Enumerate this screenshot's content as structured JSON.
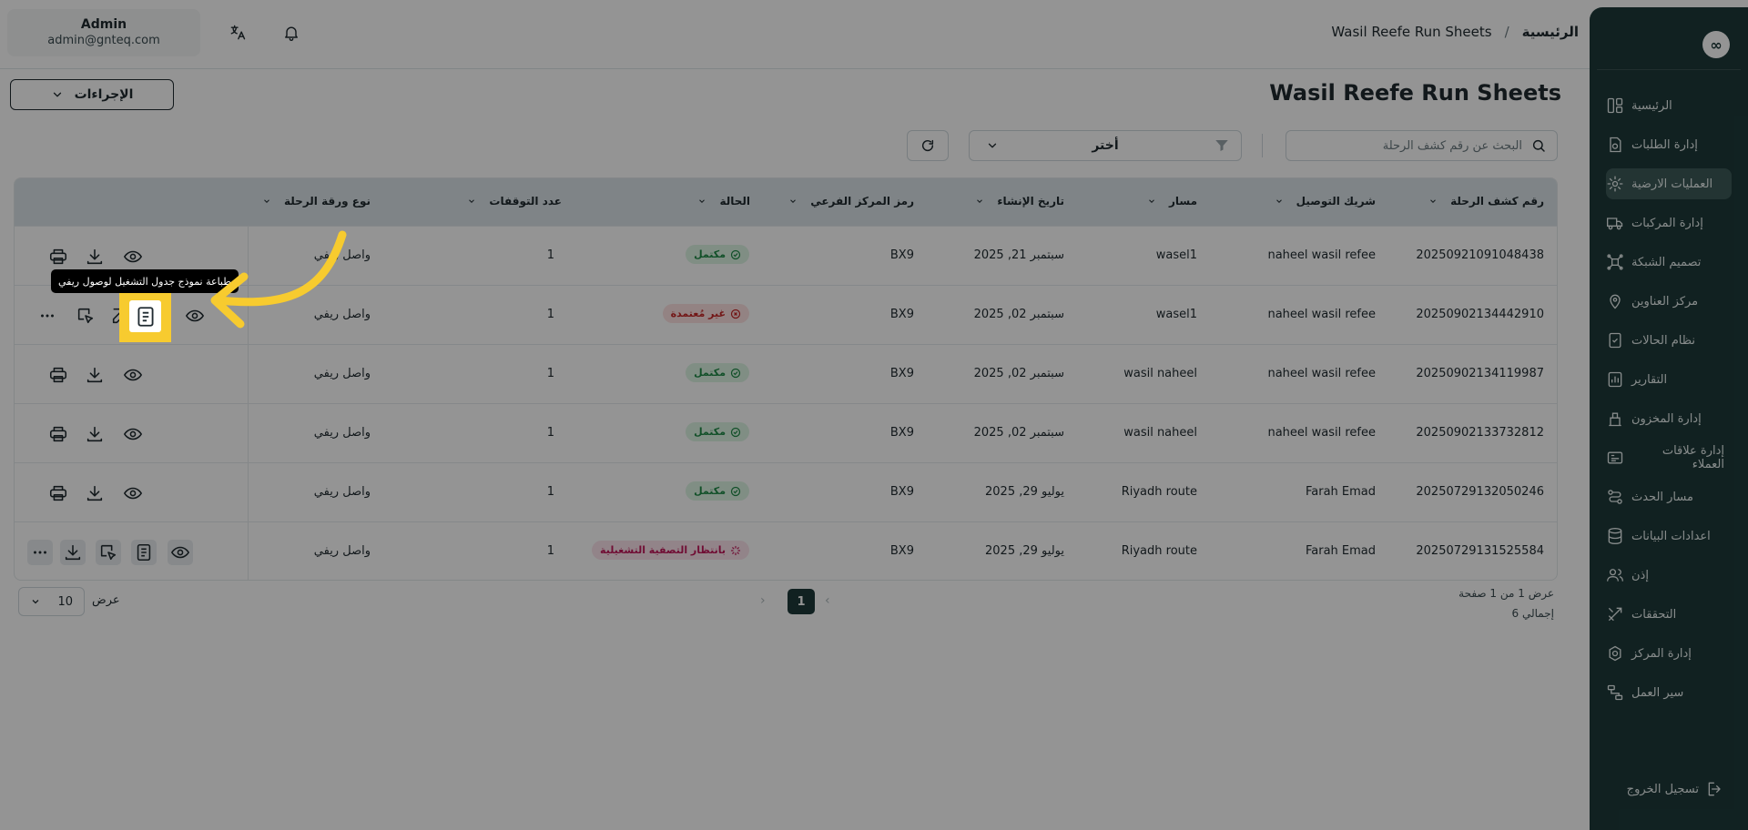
{
  "user": {
    "name": "Admin",
    "email": "admin@gnteq.com"
  },
  "breadcrumb": {
    "home": "الرئيسية",
    "separator": "/",
    "current": "Wasil Reefe Run Sheets"
  },
  "page": {
    "title": "Wasil Reefe Run Sheets",
    "actions_label": "الإجراءات"
  },
  "filters": {
    "search_placeholder": "البحث عن رقم كشف الرحلة",
    "select_value": "أختر"
  },
  "sidebar": {
    "logo": "∞",
    "items": [
      {
        "label": "الرئيسية",
        "icon": "layout-icon"
      },
      {
        "label": "إدارة الطلبات",
        "icon": "orders-icon"
      },
      {
        "label": "العمليات الارضية",
        "icon": "ground-ops-icon",
        "active": true
      },
      {
        "label": "إدارة المركبات",
        "icon": "truck-icon"
      },
      {
        "label": "تصميم الشبكة",
        "icon": "network-icon"
      },
      {
        "label": "مركز العناوين",
        "icon": "map-pin-icon"
      },
      {
        "label": "نظام الحالات",
        "icon": "status-icon"
      },
      {
        "label": "التقارير",
        "icon": "report-icon"
      },
      {
        "label": "إدارة المخزون",
        "icon": "inventory-icon"
      },
      {
        "label": "إدارة علاقات العملاء",
        "icon": "crm-icon"
      },
      {
        "label": "مسار الحدث",
        "icon": "route-icon"
      },
      {
        "label": "اعدادات البيانات",
        "icon": "database-icon"
      },
      {
        "label": "إذن",
        "icon": "users-icon"
      },
      {
        "label": "التحققات",
        "icon": "tools-icon"
      },
      {
        "label": "إدارة المركز",
        "icon": "hub-gear-icon"
      },
      {
        "label": "سير العمل",
        "icon": "workflow-icon"
      }
    ],
    "logout": "تسجيل الخروج"
  },
  "table": {
    "columns": [
      "رقم كشف الرحلة",
      "شريك التوصيل",
      "مسار",
      "تاريخ الإنشاء",
      "رمز المركز الفرعي",
      "الحالة",
      "عدد التوقفات",
      "نوع ورقة الرحلة"
    ],
    "rows": [
      {
        "id": "20250921091048438",
        "partner": "naheel wasil refee",
        "route": "wasel1",
        "date": "سبتمبر 21, 2025",
        "hub": "BX9",
        "status": "مكتمل",
        "stops": "1",
        "type": "واصل ريفي"
      },
      {
        "id": "20250902134442910",
        "partner": "naheel wasil refee",
        "route": "wasel1",
        "date": "سبتمبر 02, 2025",
        "hub": "BX9",
        "status": "غير مُعتمدة",
        "stops": "1",
        "type": "واصل ريفي"
      },
      {
        "id": "20250902134119987",
        "partner": "naheel wasil refee",
        "route": "wasil naheel",
        "date": "سبتمبر 02, 2025",
        "hub": "BX9",
        "status": "مكتمل",
        "stops": "1",
        "type": "واصل ريفي"
      },
      {
        "id": "20250902133732812",
        "partner": "naheel wasil refee",
        "route": "wasil naheel",
        "date": "سبتمبر 02, 2025",
        "hub": "BX9",
        "status": "مكتمل",
        "stops": "1",
        "type": "واصل ريفي"
      },
      {
        "id": "20250729132050246",
        "partner": "Farah Emad",
        "route": "Riyadh route",
        "date": "يوليو 29, 2025",
        "hub": "BX9",
        "status": "مكتمل",
        "stops": "1",
        "type": "واصل ريفي"
      },
      {
        "id": "20250729131525584",
        "partner": "Farah Emad",
        "route": "Riyadh route",
        "date": "يوليو 29, 2025",
        "hub": "BX9",
        "status": "بانتظار التصفية التشغيلية",
        "stops": "1",
        "type": "واصل ريفي"
      }
    ]
  },
  "pagination": {
    "info": "عرض 1 من 1 صفحة",
    "total": "إجمالي 6",
    "current_page": "1",
    "per_page": "10",
    "per_page_label": "عرض"
  },
  "tooltip": "طباعة نموذج جدول التشغيل لوصول ريفي",
  "colors": {
    "sidebar": "#1e3a3a",
    "highlight": "#f7cb2f",
    "arrow": "#f7cb2f",
    "complete": "#1f8a47",
    "rejected": "#c62828",
    "pending": "#c2185b"
  }
}
